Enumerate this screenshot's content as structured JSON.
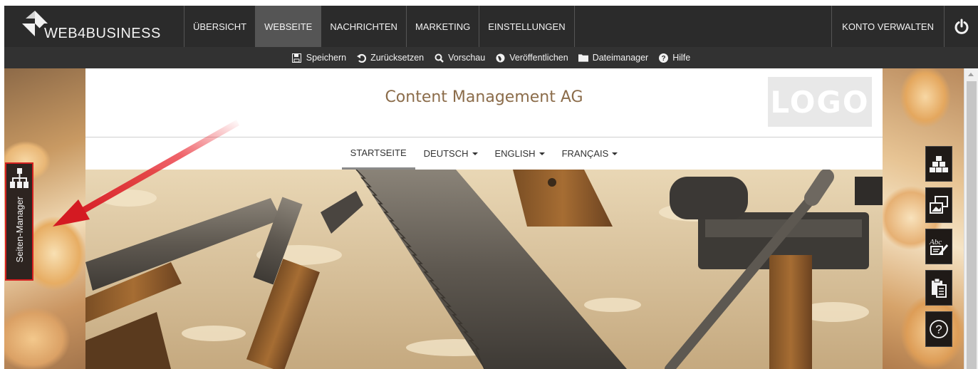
{
  "brand": {
    "name": "WEB4BUSINESS",
    "logo_icon": "diamond-arrows-logo"
  },
  "main_nav": [
    {
      "label": "ÜBERSICHT",
      "active": false
    },
    {
      "label": "WEBSEITE",
      "active": true
    },
    {
      "label": "NACHRICHTEN",
      "active": false
    },
    {
      "label": "MARKETING",
      "active": false
    },
    {
      "label": "EINSTELLUNGEN",
      "active": false
    }
  ],
  "account": {
    "label": "KONTO VERWALTEN",
    "power_icon": "power-icon"
  },
  "toolbar": [
    {
      "label": "Speichern",
      "icon": "floppy-disk-icon"
    },
    {
      "label": "Zurücksetzen",
      "icon": "undo-icon"
    },
    {
      "label": "Vorschau",
      "icon": "magnifier-icon"
    },
    {
      "label": "Veröffentlichen",
      "icon": "globe-icon"
    },
    {
      "label": "Dateimanager",
      "icon": "folder-icon"
    },
    {
      "label": "Hilfe",
      "icon": "question-icon"
    }
  ],
  "site": {
    "title": "Content Management AG",
    "logo_text": "LOGO",
    "nav": [
      {
        "label": "STARTSEITE",
        "active": true,
        "dropdown": false
      },
      {
        "label": "DEUTSCH",
        "active": false,
        "dropdown": true
      },
      {
        "label": "ENGLISH",
        "active": false,
        "dropdown": true
      },
      {
        "label": "FRANÇAIS",
        "active": false,
        "dropdown": true
      }
    ],
    "hero_image": "woodworking-tools-on-shavings"
  },
  "side_panel": {
    "label": "Seiten-Manager",
    "icon": "sitemap-icon"
  },
  "right_tools": [
    {
      "icon": "blocks-icon"
    },
    {
      "icon": "image-gallery-icon"
    },
    {
      "icon": "text-edit-icon"
    },
    {
      "icon": "clipboard-icon"
    },
    {
      "icon": "help-circle-icon"
    }
  ],
  "colors": {
    "nav_bg": "#2b2b2b",
    "active_tab": "#555555",
    "title_color": "#8b6c4a",
    "highlight_red": "#d42020"
  }
}
